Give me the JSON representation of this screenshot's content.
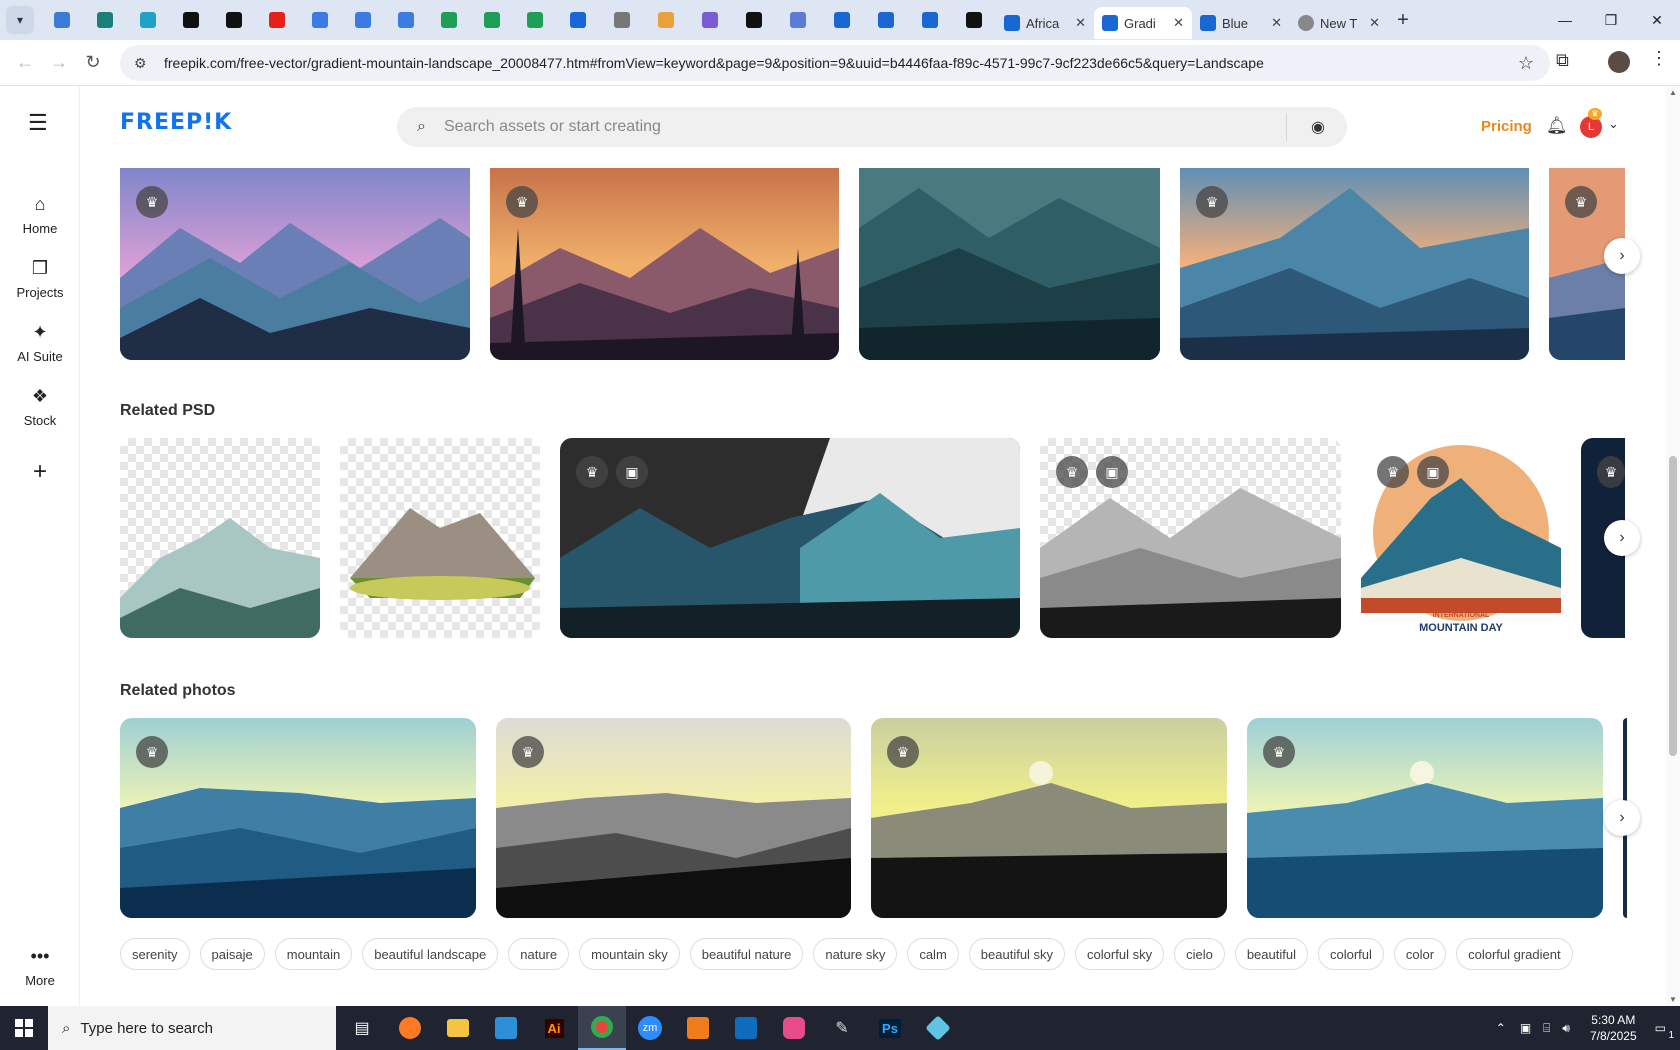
{
  "browser": {
    "pinned_tabs": [
      {
        "icon": "edge-globe-icon",
        "color": "#3b7bd8"
      },
      {
        "icon": "shield-v-icon",
        "color": "#1a7f7a"
      },
      {
        "icon": "hex-app-icon",
        "color": "#1fa3c4"
      },
      {
        "icon": "chatgpt-icon",
        "color": "#111111"
      },
      {
        "icon": "bolt-app-icon",
        "color": "#111111"
      },
      {
        "icon": "youtube-icon",
        "color": "#e62117"
      },
      {
        "icon": "google-docs-icon",
        "color": "#3c7ae4"
      },
      {
        "icon": "google-docs-icon",
        "color": "#3c7ae4"
      },
      {
        "icon": "google-docs-icon",
        "color": "#3c7ae4"
      },
      {
        "icon": "google-sheets-icon",
        "color": "#1e9e57"
      },
      {
        "icon": "google-sheets-icon",
        "color": "#1e9e57"
      },
      {
        "icon": "google-sheets-icon",
        "color": "#1e9e57"
      },
      {
        "icon": "mj-app-icon",
        "color": "#1867d9"
      },
      {
        "icon": "globe-icon",
        "color": "#777777"
      },
      {
        "icon": "bird-icon",
        "color": "#e9a13b"
      },
      {
        "icon": "code-braces-icon",
        "color": "#7a5bd6"
      },
      {
        "icon": "ai-tool-icon",
        "color": "#111111"
      },
      {
        "icon": "grid-app-icon",
        "color": "#5b7bd6"
      },
      {
        "icon": "word-doc-icon",
        "color": "#1967d2"
      },
      {
        "icon": "word-doc-icon",
        "color": "#1967d2"
      },
      {
        "icon": "word-doc-icon",
        "color": "#1967d2"
      },
      {
        "icon": "medium-icon",
        "color": "#111111"
      }
    ],
    "tabs": [
      {
        "title": "Africa",
        "icon": "word-doc-icon",
        "active": false
      },
      {
        "title": "Gradi",
        "icon": "word-doc-icon",
        "active": true
      },
      {
        "title": "Blue",
        "icon": "word-doc-icon",
        "active": false
      },
      {
        "title": "New T",
        "icon": "chrome-icon",
        "active": false
      }
    ],
    "new_tab": "+",
    "url": "freepik.com/free-vector/gradient-mountain-landscape_20008477.htm#fromView=keyword&page=9&position=9&uuid=b4446faa-f89c-4571-99c7-9cf223de66c5&query=Landscape"
  },
  "sidenav": {
    "items": [
      {
        "label": "Home",
        "icon": "home-icon"
      },
      {
        "label": "Projects",
        "icon": "projects-icon"
      },
      {
        "label": "AI Suite",
        "icon": "sparkle-icon"
      },
      {
        "label": "Stock",
        "icon": "stock-icon"
      }
    ],
    "more_label": "More"
  },
  "header": {
    "logo": "FREEP!K",
    "search_placeholder": "Search assets or start creating",
    "pricing": "Pricing",
    "avatar_initial": "L"
  },
  "sections": {
    "related_psd": "Related PSD",
    "related_photos": "Related photos"
  },
  "tags": [
    "serenity",
    "paisaje",
    "mountain",
    "beautiful landscape",
    "nature",
    "mountain sky",
    "beautiful nature",
    "nature sky",
    "calm",
    "beautiful sky",
    "colorful sky",
    "cielo",
    "beautiful",
    "colorful",
    "color",
    "colorful gradient"
  ],
  "psd_caption": {
    "line1": "INTERNATIONAL",
    "line2": "MOUNTAIN DAY"
  },
  "taskbar": {
    "search_placeholder": "Type here to search",
    "time": "5:30 AM",
    "date": "7/8/2025",
    "notifications": "1"
  }
}
